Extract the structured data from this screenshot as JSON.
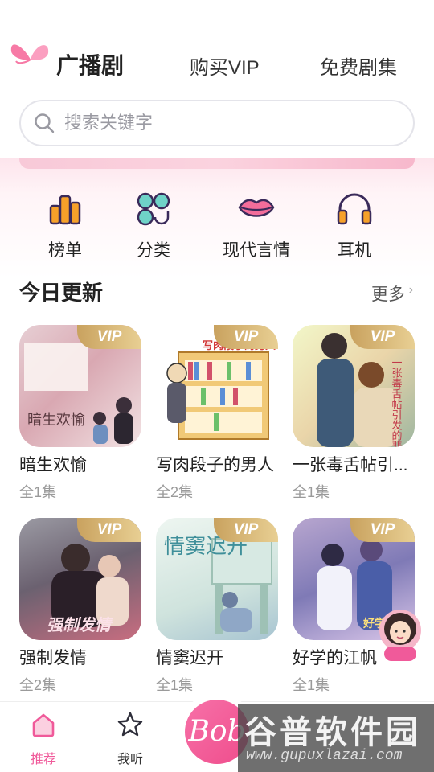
{
  "header": {
    "tabs": [
      {
        "label": "广播剧",
        "active": true
      },
      {
        "label": "购买VIP",
        "active": false
      },
      {
        "label": "免费剧集",
        "active": false
      }
    ]
  },
  "search": {
    "placeholder": "搜索关键字",
    "icon": "search-icon"
  },
  "categories": [
    {
      "label": "榜单",
      "icon": "ranking-icon",
      "color": "#f6a12a"
    },
    {
      "label": "分类",
      "icon": "category-icon",
      "color": "#6fd3c8"
    },
    {
      "label": "现代言情",
      "icon": "lips-icon",
      "color": "#f36d9a"
    },
    {
      "label": "耳机",
      "icon": "headphones-icon",
      "color": "#f6a12a"
    }
  ],
  "section": {
    "title": "今日更新",
    "more": "更多",
    "more_icon": "chevron-right-icon"
  },
  "vip_badge": "VIP",
  "dramas": [
    {
      "title": "暗生欢愉",
      "episodes": "全1集",
      "vip": true
    },
    {
      "title": "写肉段子的男人",
      "episodes": "全2集",
      "vip": true
    },
    {
      "title": "一张毒舌帖引...",
      "episodes": "全1集",
      "vip": true
    },
    {
      "title": "强制发情",
      "episodes": "全2集",
      "vip": true
    },
    {
      "title": "情窦迟开",
      "episodes": "全1集",
      "vip": true
    },
    {
      "title": "好学的江帆",
      "episodes": "全1集",
      "vip": true
    }
  ],
  "cover_text": {
    "c1": "暗生欢愉",
    "c2": "写肉段子的男人",
    "c3": "一张毒舌帖引发的悲剧",
    "c4": "强制发情",
    "c5": "情窦迟开",
    "c6": "好学的"
  },
  "bottom_nav": [
    {
      "label": "推荐",
      "icon": "home-icon",
      "active": true
    },
    {
      "label": "我听",
      "icon": "star-icon",
      "active": false
    }
  ],
  "center_button": {
    "label": "Bob",
    "icon": "play-logo-icon"
  },
  "watermark": {
    "text": "谷普软件园",
    "url": "www.gupuxlazai.com"
  },
  "colors": {
    "accent": "#f05a9a",
    "vip_gold": "#c9a25f",
    "text": "#222222",
    "muted": "#9a9a9a"
  }
}
